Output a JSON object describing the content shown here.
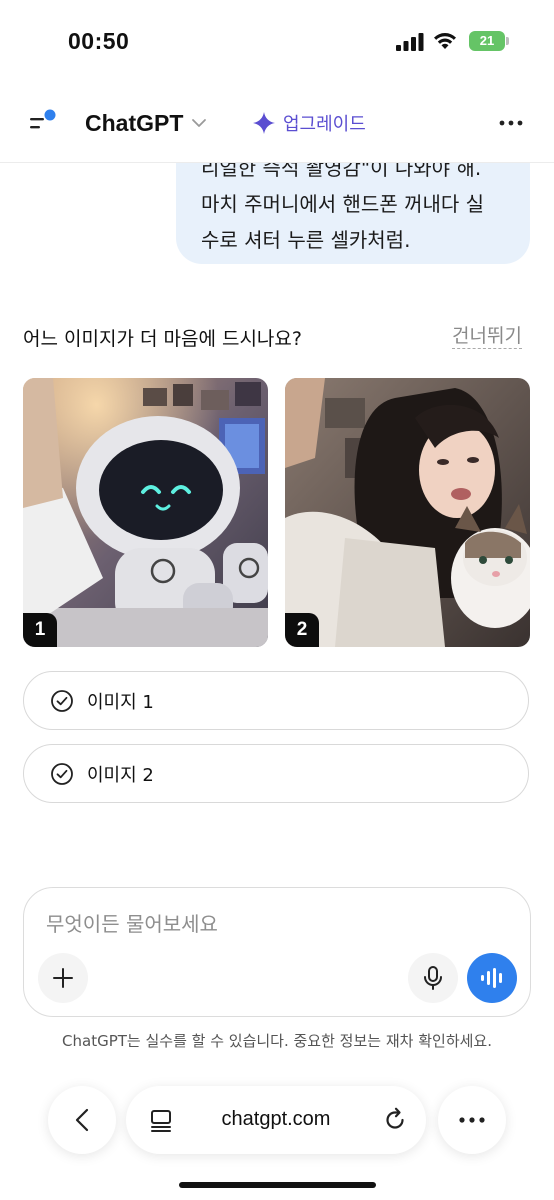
{
  "status_bar": {
    "time": "00:50",
    "battery": "21"
  },
  "header": {
    "title": "ChatGPT",
    "upgrade_label": "업그레이드"
  },
  "message": {
    "lines": [
      "리얼한 즉석 촬영감\"이 나와야 해.",
      "마치 주머니에서 핸드폰 꺼내다 실",
      "수로 셔터 누른 셀카처럼."
    ]
  },
  "comparison": {
    "question": "어느 이미지가 더 마음에 드시나요?",
    "skip_label": "건너뛰기",
    "images": [
      {
        "badge": "1",
        "description": "robot selfie"
      },
      {
        "badge": "2",
        "description": "girl with cat selfie"
      }
    ],
    "choices": [
      {
        "label": "이미지 1"
      },
      {
        "label": "이미지 2"
      }
    ]
  },
  "composer": {
    "placeholder": "무엇이든 물어보세요"
  },
  "disclaimer": "ChatGPT는 실수를 할 수 있습니다. 중요한 정보는 재차 확인하세요.",
  "browser": {
    "url": "chatgpt.com"
  },
  "colors": {
    "accent": "#2f80ed",
    "upgrade": "#5b4ed1",
    "bubble": "#e8f1fb",
    "badge_bg": "#0d0d0d"
  }
}
